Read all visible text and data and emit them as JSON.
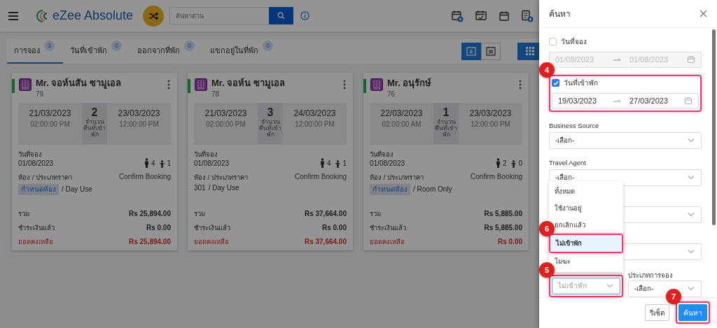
{
  "topbar": {
    "logo": "eZee Absolute",
    "search": {
      "placeholder": "ค้นหาด่วน"
    }
  },
  "tabs": [
    {
      "label": "การจอง",
      "count": "3",
      "selected": true
    },
    {
      "label": "วันที่เข้าพัก",
      "count": "0",
      "selected": false
    },
    {
      "label": "ออกจากที่พัก",
      "count": "0",
      "selected": false
    },
    {
      "label": "แขกอยู่ในที่พัก",
      "count": "0",
      "selected": false
    }
  ],
  "view_toggles": [
    {
      "selected": true
    },
    {
      "selected": false
    }
  ],
  "bookings": [
    {
      "name": "Mr. จอห์นสัน ซามูเอล",
      "number": "79",
      "color": "#14672c",
      "arrival": {
        "date": "21/03/2023",
        "time": "02:00:00 PM"
      },
      "nights": "2",
      "nights_label": "จำนวนคืนที่เข้าพัก",
      "departure": {
        "date": "23/03/2023",
        "time": "12:00:00 PM"
      },
      "booking_date_label": "วันที่จอง",
      "booking_date": "01/08/2023",
      "adults": "4",
      "children": "1",
      "room_label": "ห้อง / ประเภทราคา",
      "status": "Confirm Booking",
      "room": {
        "text": "กำหนดห้อง",
        "assigned": false
      },
      "rate": "/ Day Use",
      "totals": [
        {
          "label": "รวม",
          "value": "Rs 25,894.00",
          "kind": "normal"
        },
        {
          "label": "ชำระเงินแล้ว",
          "value": "Rs 0.00",
          "kind": "normal"
        },
        {
          "label": "ยอดคงเหลือ",
          "value": "Rs 25,894.00",
          "kind": "due"
        }
      ]
    },
    {
      "name": "Mr. จอห์น ซามูเอล",
      "number": "78",
      "color": "#14672c",
      "arrival": {
        "date": "21/03/2023",
        "time": "02:00:00 PM"
      },
      "nights": "3",
      "nights_label": "จำนวนคืนที่เข้าพัก",
      "departure": {
        "date": "24/03/2023",
        "time": "12:00:00 PM"
      },
      "booking_date_label": "วันที่จอง",
      "booking_date": "01/08/2023",
      "adults": "4",
      "children": "1",
      "room_label": "ห้อง / ประเภทราคา",
      "status": "Confirm Booking",
      "room": {
        "text": "301",
        "assigned": true
      },
      "rate": "/ Day Use",
      "totals": [
        {
          "label": "รวม",
          "value": "Rs 37,664.00",
          "kind": "normal"
        },
        {
          "label": "ชำระเงินแล้ว",
          "value": "Rs 0.00",
          "kind": "normal"
        },
        {
          "label": "ยอดคงเหลือ",
          "value": "Rs 37,664.00",
          "kind": "due"
        }
      ]
    },
    {
      "name": "Mr. อนุรักษ์",
      "number": "76",
      "color": "#14672c",
      "arrival": {
        "date": "22/03/2023",
        "time": "02:00:00 AM"
      },
      "nights": "1",
      "nights_label": "จำนวนคืนที่เข้าพัก",
      "departure": {
        "date": "23/03/2023",
        "time": "12:00:00 PM"
      },
      "booking_date_label": "วันที่จอง",
      "booking_date": "01/08/2023",
      "adults": "2",
      "children": "0",
      "room_label": "ห้อง / ประเภทราคา",
      "status": "Confirm Booking",
      "room": {
        "text": "กำหนดห้อง",
        "assigned": false
      },
      "rate": "/ Room Only",
      "totals": [
        {
          "label": "รวม",
          "value": "Rs 5,885.00",
          "kind": "normal"
        },
        {
          "label": "ชำระเงินแล้ว",
          "value": "Rs 5,885.00",
          "kind": "normal"
        },
        {
          "label": "ยอดคงเหลือ",
          "value": "Rs 0.00",
          "kind": "due"
        }
      ]
    }
  ],
  "search_panel": {
    "title": "ค้นหา",
    "date_filters": [
      {
        "label": "วันที่จอง",
        "checked": false,
        "from": "01/08/2023",
        "to": "01/08/2023"
      },
      {
        "label": "วันที่เข้าพัก",
        "checked": true,
        "from": "19/03/2023",
        "to": "27/03/2023",
        "callout": "4"
      }
    ],
    "selects": [
      {
        "label": "Business Source",
        "value": "-เลือก-"
      },
      {
        "label": "Travel Agent",
        "value": "-เลือก-"
      }
    ],
    "status_select": {
      "value": "ไม่เข้าพัก",
      "open": true,
      "callout": "5",
      "options": [
        {
          "label": "ทั้งหมด",
          "selected": false
        },
        {
          "label": "ใช้งานอยู่",
          "selected": false
        },
        {
          "label": "ยกเลิกแล้ว",
          "selected": false
        },
        {
          "label": "ไม่เข้าพัก",
          "selected": true,
          "callout": "6"
        },
        {
          "label": "โมฆะ",
          "selected": false
        }
      ]
    },
    "booking_type": {
      "label": "ประเภทการจอง",
      "value": "-เลือก-"
    },
    "buttons": [
      {
        "label": "รีเซ็ต",
        "kind": "secondary"
      },
      {
        "label": "ค้นหา",
        "kind": "primary",
        "callout": "7"
      }
    ]
  }
}
